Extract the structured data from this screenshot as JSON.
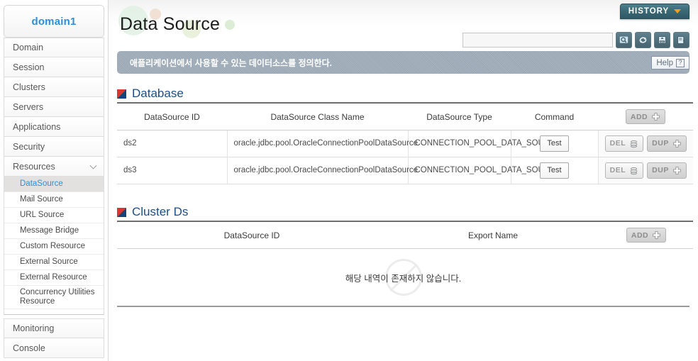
{
  "sidebar": {
    "domain_name": "domain1",
    "items": [
      {
        "label": "Domain",
        "expandable": false
      },
      {
        "label": "Session",
        "expandable": false
      },
      {
        "label": "Clusters",
        "expandable": false
      },
      {
        "label": "Servers",
        "expandable": false
      },
      {
        "label": "Applications",
        "expandable": false
      },
      {
        "label": "Security",
        "expandable": false
      },
      {
        "label": "Resources",
        "expandable": true
      }
    ],
    "sub_items": [
      {
        "label": "DataSource",
        "active": true
      },
      {
        "label": "Mail Source",
        "active": false
      },
      {
        "label": "URL Source",
        "active": false
      },
      {
        "label": "Message Bridge",
        "active": false
      },
      {
        "label": "Custom Resource",
        "active": false
      },
      {
        "label": "External Source",
        "active": false
      },
      {
        "label": "External Resource",
        "active": false
      },
      {
        "label": "Concurrency Utilities Resource",
        "active": false
      }
    ],
    "lower_items": [
      {
        "label": "Monitoring"
      },
      {
        "label": "Console"
      }
    ],
    "active_color": "#2e8fd4"
  },
  "header": {
    "page_title": "Data Source",
    "history_label": "HISTORY",
    "history_color": "#3b6a77",
    "history_chevron_color": "#f0a21e"
  },
  "search": {
    "value": "",
    "placeholder": "",
    "icons": [
      {
        "name": "search-icon"
      },
      {
        "name": "refresh-icon"
      },
      {
        "name": "xml-export-icon"
      },
      {
        "name": "export-icon"
      }
    ]
  },
  "notice": {
    "text": "애플리케이션에서 사용할 수 있는 데이터소스를 정의한다."
  },
  "help": {
    "label": "Help",
    "glyph": "?"
  },
  "sections": [
    {
      "id": "database",
      "title": "Database",
      "add_label": "ADD",
      "columns": [
        "DataSource ID",
        "DataSource Class Name",
        "DataSource Type",
        "Command",
        ""
      ],
      "rows": [
        {
          "datasource_id": "ds2",
          "class_name": "oracle.jdbc.pool.OracleConnectionPoolDataSource",
          "type": "CONNECTION_POOL_DATA_SOURCE",
          "command_label": "Test",
          "del_label": "DEL",
          "dup_label": "DUP"
        },
        {
          "datasource_id": "ds3",
          "class_name": "oracle.jdbc.pool.OracleConnectionPoolDataSource",
          "type": "CONNECTION_POOL_DATA_SOURCE",
          "command_label": "Test",
          "del_label": "DEL",
          "dup_label": "DUP"
        }
      ]
    },
    {
      "id": "cluster-ds",
      "title": "Cluster Ds",
      "add_label": "ADD",
      "columns": [
        "DataSource ID",
        "Export Name",
        ""
      ],
      "empty_text": "해당 내역이 존재하지 않습니다."
    }
  ]
}
